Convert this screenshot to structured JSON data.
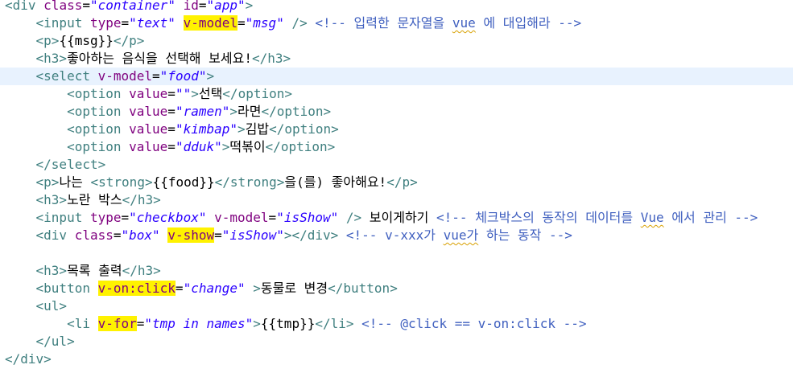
{
  "editor": {
    "lines": [
      {
        "indent": "",
        "tokens": [
          {
            "t": "<div ",
            "c": "tag"
          },
          {
            "t": "class",
            "c": "attr"
          },
          {
            "t": "=",
            "c": "txt"
          },
          {
            "t": "\"container\"",
            "c": "val"
          },
          {
            "t": " ",
            "c": "txt"
          },
          {
            "t": "id",
            "c": "attr"
          },
          {
            "t": "=",
            "c": "txt"
          },
          {
            "t": "\"app\"",
            "c": "val"
          },
          {
            "t": ">",
            "c": "tag"
          }
        ]
      },
      {
        "indent": "    ",
        "tokens": [
          {
            "t": "<input ",
            "c": "tag"
          },
          {
            "t": "type",
            "c": "attr"
          },
          {
            "t": "=",
            "c": "txt"
          },
          {
            "t": "\"text\"",
            "c": "val"
          },
          {
            "t": " ",
            "c": "txt"
          },
          {
            "t": "v-model",
            "c": "attr hl"
          },
          {
            "t": "=",
            "c": "txt"
          },
          {
            "t": "\"msg\"",
            "c": "val"
          },
          {
            "t": " />",
            "c": "tag"
          },
          {
            "t": " <!-- 입력한 문자열을 ",
            "c": "cmt"
          },
          {
            "t": "vue",
            "c": "cmt sq"
          },
          {
            "t": " 에 대입해라 -->",
            "c": "cmt"
          }
        ]
      },
      {
        "indent": "    ",
        "tokens": [
          {
            "t": "<p>",
            "c": "tag"
          },
          {
            "t": "{{msg}}",
            "c": "txt"
          },
          {
            "t": "</p>",
            "c": "tag"
          }
        ]
      },
      {
        "indent": "    ",
        "tokens": [
          {
            "t": "<h3>",
            "c": "tag"
          },
          {
            "t": "좋아하는 음식을 선택해 보세요!",
            "c": "txt"
          },
          {
            "t": "</h3>",
            "c": "tag"
          }
        ]
      },
      {
        "indent": "    ",
        "current": true,
        "tokens": [
          {
            "t": "<select ",
            "c": "tag"
          },
          {
            "t": "v-model",
            "c": "attr"
          },
          {
            "t": "=",
            "c": "txt"
          },
          {
            "t": "\"food\"",
            "c": "val"
          },
          {
            "t": ">",
            "c": "tag"
          }
        ]
      },
      {
        "indent": "        ",
        "tokens": [
          {
            "t": "<option ",
            "c": "tag"
          },
          {
            "t": "value",
            "c": "attr"
          },
          {
            "t": "=",
            "c": "txt"
          },
          {
            "t": "\"\"",
            "c": "val"
          },
          {
            "t": ">",
            "c": "tag"
          },
          {
            "t": "선택",
            "c": "txt"
          },
          {
            "t": "</option>",
            "c": "tag"
          }
        ]
      },
      {
        "indent": "        ",
        "tokens": [
          {
            "t": "<option ",
            "c": "tag"
          },
          {
            "t": "value",
            "c": "attr"
          },
          {
            "t": "=",
            "c": "txt"
          },
          {
            "t": "\"ramen\"",
            "c": "val"
          },
          {
            "t": ">",
            "c": "tag"
          },
          {
            "t": "라면",
            "c": "txt"
          },
          {
            "t": "</option>",
            "c": "tag"
          }
        ]
      },
      {
        "indent": "        ",
        "tokens": [
          {
            "t": "<option ",
            "c": "tag"
          },
          {
            "t": "value",
            "c": "attr"
          },
          {
            "t": "=",
            "c": "txt"
          },
          {
            "t": "\"kimbap\"",
            "c": "val"
          },
          {
            "t": ">",
            "c": "tag"
          },
          {
            "t": "김밥",
            "c": "txt"
          },
          {
            "t": "</option>",
            "c": "tag"
          }
        ]
      },
      {
        "indent": "        ",
        "tokens": [
          {
            "t": "<option ",
            "c": "tag"
          },
          {
            "t": "value",
            "c": "attr"
          },
          {
            "t": "=",
            "c": "txt"
          },
          {
            "t": "\"dduk\"",
            "c": "val"
          },
          {
            "t": ">",
            "c": "tag"
          },
          {
            "t": "떡볶이",
            "c": "txt"
          },
          {
            "t": "</option>",
            "c": "tag"
          }
        ]
      },
      {
        "indent": "    ",
        "tokens": [
          {
            "t": "</select>",
            "c": "tag"
          }
        ]
      },
      {
        "indent": "    ",
        "tokens": [
          {
            "t": "<p>",
            "c": "tag"
          },
          {
            "t": "나는 ",
            "c": "txt"
          },
          {
            "t": "<strong>",
            "c": "tag"
          },
          {
            "t": "{{food}}",
            "c": "txt"
          },
          {
            "t": "</strong>",
            "c": "tag"
          },
          {
            "t": "을(를) 좋아해요!",
            "c": "txt"
          },
          {
            "t": "</p>",
            "c": "tag"
          }
        ]
      },
      {
        "indent": "    ",
        "tokens": [
          {
            "t": "<h3>",
            "c": "tag"
          },
          {
            "t": "노란 박스",
            "c": "txt"
          },
          {
            "t": "</h3>",
            "c": "tag"
          }
        ]
      },
      {
        "indent": "    ",
        "tokens": [
          {
            "t": "<input ",
            "c": "tag"
          },
          {
            "t": "type",
            "c": "attr"
          },
          {
            "t": "=",
            "c": "txt"
          },
          {
            "t": "\"checkbox\"",
            "c": "val"
          },
          {
            "t": " ",
            "c": "txt"
          },
          {
            "t": "v-model",
            "c": "attr"
          },
          {
            "t": "=",
            "c": "txt"
          },
          {
            "t": "\"isShow\"",
            "c": "val"
          },
          {
            "t": " />",
            "c": "tag"
          },
          {
            "t": " 보이게하기 ",
            "c": "txt"
          },
          {
            "t": "<!-- 체크박스의 동작의 데이터를 ",
            "c": "cmt"
          },
          {
            "t": "Vue",
            "c": "cmt sq"
          },
          {
            "t": " 에서 관리 -->",
            "c": "cmt"
          }
        ]
      },
      {
        "indent": "    ",
        "tokens": [
          {
            "t": "<div ",
            "c": "tag"
          },
          {
            "t": "class",
            "c": "attr"
          },
          {
            "t": "=",
            "c": "txt"
          },
          {
            "t": "\"box\"",
            "c": "val"
          },
          {
            "t": " ",
            "c": "txt"
          },
          {
            "t": "v-show",
            "c": "attr hl"
          },
          {
            "t": "=",
            "c": "txt"
          },
          {
            "t": "\"isShow\"",
            "c": "val"
          },
          {
            "t": ">",
            "c": "tag"
          },
          {
            "t": "</div>",
            "c": "tag"
          },
          {
            "t": " <!-- v-xxx가 ",
            "c": "cmt"
          },
          {
            "t": "vue가",
            "c": "cmt sq"
          },
          {
            "t": " 하는 동작 -->",
            "c": "cmt"
          }
        ]
      },
      {
        "indent": "",
        "tokens": []
      },
      {
        "indent": "    ",
        "tokens": [
          {
            "t": "<h3>",
            "c": "tag"
          },
          {
            "t": "목록 출력",
            "c": "txt"
          },
          {
            "t": "</h3>",
            "c": "tag"
          }
        ]
      },
      {
        "indent": "    ",
        "tokens": [
          {
            "t": "<button ",
            "c": "tag"
          },
          {
            "t": "v-on:click",
            "c": "attr hl"
          },
          {
            "t": "=",
            "c": "txt"
          },
          {
            "t": "\"change\"",
            "c": "val"
          },
          {
            "t": " >",
            "c": "tag"
          },
          {
            "t": "동물로 변경",
            "c": "txt"
          },
          {
            "t": "</button>",
            "c": "tag"
          }
        ]
      },
      {
        "indent": "    ",
        "tokens": [
          {
            "t": "<ul>",
            "c": "tag"
          }
        ]
      },
      {
        "indent": "        ",
        "tokens": [
          {
            "t": "<li ",
            "c": "tag"
          },
          {
            "t": "v-for",
            "c": "attr hl"
          },
          {
            "t": "=",
            "c": "txt"
          },
          {
            "t": "\"tmp in names\"",
            "c": "val"
          },
          {
            "t": ">",
            "c": "tag"
          },
          {
            "t": "{{tmp}}",
            "c": "txt"
          },
          {
            "t": "</li>",
            "c": "tag"
          },
          {
            "t": " <!-- @click == v-on:click -->",
            "c": "cmt"
          }
        ]
      },
      {
        "indent": "    ",
        "tokens": [
          {
            "t": "</ul>",
            "c": "tag"
          }
        ]
      },
      {
        "indent": "",
        "tokens": [
          {
            "t": "</div>",
            "c": "tag"
          }
        ]
      }
    ]
  }
}
